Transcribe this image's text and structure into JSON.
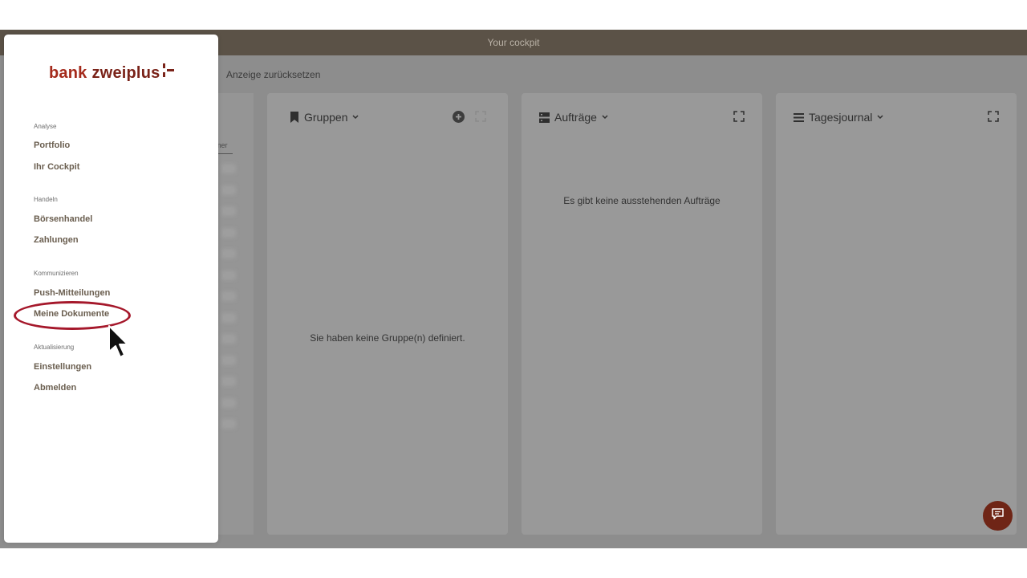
{
  "app": {
    "title": "Your cockpit",
    "reset_view": "Anzeige zurücksetzen",
    "partial_column_header": "mer"
  },
  "panels": {
    "groups": {
      "title": "Gruppen",
      "empty": "Sie haben keine Gruppe(n) definiert."
    },
    "orders": {
      "title": "Aufträge",
      "empty": "Es gibt keine ausstehenden Aufträge"
    },
    "journal": {
      "title": "Tagesjournal"
    }
  },
  "sidebar": {
    "logo": {
      "part1": "bank",
      "part2": "zweiplus"
    },
    "sections": [
      {
        "label": "Analyse",
        "items": [
          "Portfolio",
          "Ihr Cockpit"
        ]
      },
      {
        "label": "Handeln",
        "items": [
          "Börsenhandel",
          "Zahlungen"
        ]
      },
      {
        "label": "Kommunizieren",
        "items": [
          "Push-Mitteilungen",
          "Meine Dokumente"
        ]
      },
      {
        "label": "Aktualisierung",
        "items": [
          "Einstellungen",
          "Abmelden"
        ]
      }
    ]
  },
  "colors": {
    "brand": "#7a2319",
    "highlight_ring": "#a5182b",
    "titlebar": "#5b5247"
  },
  "icons": {
    "groups": "bookmark-icon",
    "orders": "list-card-icon",
    "journal": "list-icon",
    "add": "plus-circle-icon",
    "expand": "expand-icon",
    "chat": "chat-icon"
  }
}
